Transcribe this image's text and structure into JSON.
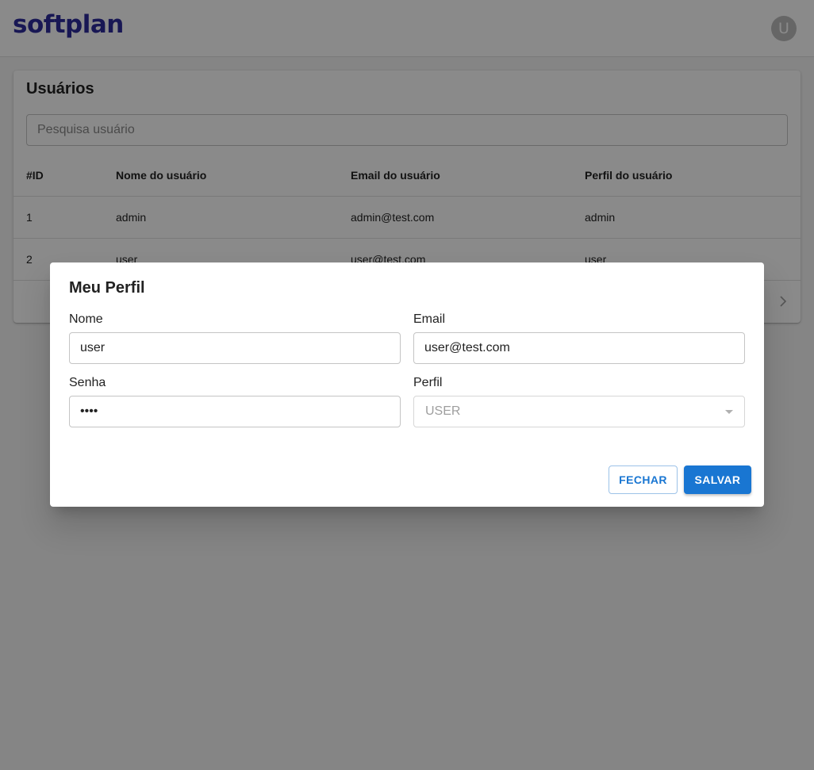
{
  "header": {
    "logo_text": "softplan",
    "avatar_initial": "U",
    "brand_color": "#2d2b9c"
  },
  "users": {
    "title": "Usuários",
    "search_placeholder": "Pesquisa usuário",
    "columns": [
      "#ID",
      "Nome do usuário",
      "Email do usuário",
      "Perfil do usuário"
    ],
    "rows": [
      [
        "1",
        "admin",
        "admin@test.com",
        "admin"
      ],
      [
        "2",
        "user",
        "user@test.com",
        "user"
      ]
    ],
    "pagination_next_icon": "chevron-right-icon"
  },
  "dialog": {
    "title": "Meu Perfil",
    "name_label": "Nome",
    "name_value": "user",
    "email_label": "Email",
    "email_value": "user@test.com",
    "password_label": "Senha",
    "password_value": "••••",
    "profile_label": "Perfil",
    "profile_value": "USER",
    "close_label": "FECHAR",
    "save_label": "SALVAR",
    "accent_color": "#1976d2"
  }
}
